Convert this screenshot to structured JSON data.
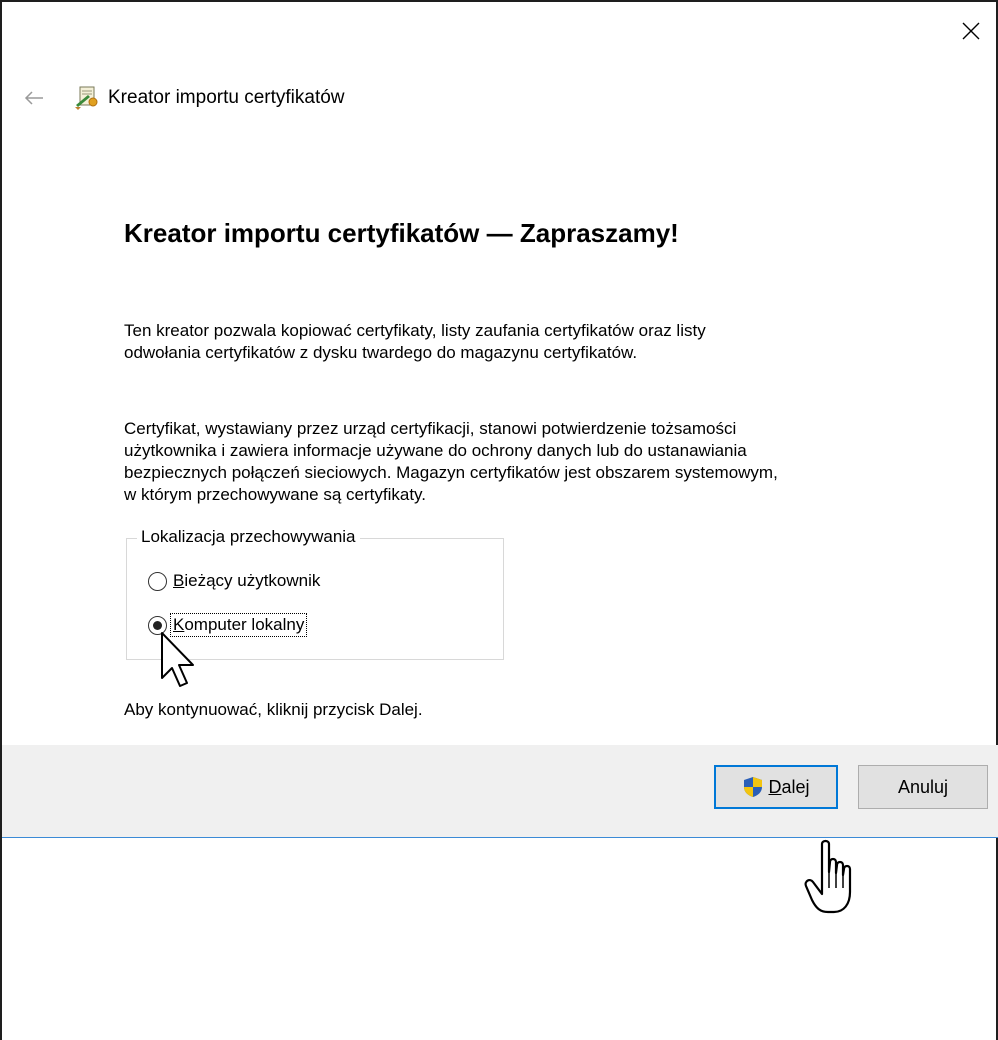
{
  "window": {
    "close_icon": "close-icon",
    "header_title": "Kreator importu certyfikatów",
    "back_icon": "back-arrow-icon",
    "wizard_icon": "certificate-wizard-icon"
  },
  "main": {
    "title": "Kreator importu certyfikatów — Zapraszamy!",
    "para1_line1": "Ten kreator pozwala kopiować certyfikaty, listy zaufania certyfikatów oraz listy",
    "para1_line2": "odwołania certyfikatów z dysku twardego do magazynu certyfikatów.",
    "para2_line1": "Certyfikat, wystawiany przez urząd certyfikacji, stanowi potwierdzenie tożsamości",
    "para2_line2": "użytkownika i zawiera informacje używane do ochrony danych lub do ustanawiania",
    "para2_line3": "bezpiecznych połączeń sieciowych. Magazyn certyfikatów jest obszarem systemowym,",
    "para2_line4": "w którym przechowywane są certyfikaty.",
    "continue_text": "Aby kontynuować, kliknij przycisk Dalej."
  },
  "storage": {
    "legend": "Lokalizacja przechowywania",
    "options": [
      {
        "first": "B",
        "rest": "ieżący użytkownik",
        "selected": false
      },
      {
        "first": "K",
        "rest": "omputer lokalny",
        "selected": true
      }
    ]
  },
  "footer": {
    "next_first": "D",
    "next_rest": "alej",
    "cancel_label": "Anuluj",
    "shield_icon": "uac-shield-icon"
  },
  "colors": {
    "accent": "#0078d7",
    "footer_bg": "#f0f0f0",
    "button_bg": "#e1e1e1"
  }
}
